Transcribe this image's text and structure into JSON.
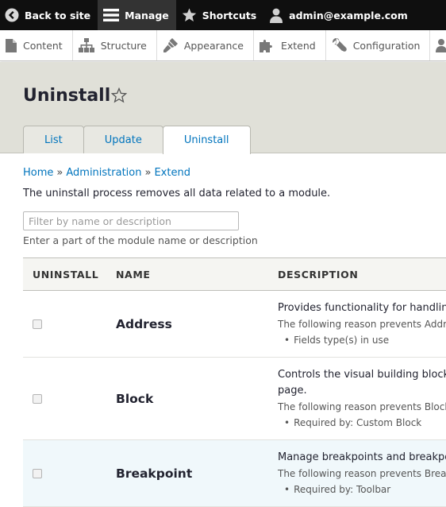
{
  "toolbar": {
    "back_label": "Back to site",
    "manage_label": "Manage",
    "shortcuts_label": "Shortcuts",
    "user_label": "admin@example.com"
  },
  "tray": {
    "items": [
      {
        "label": "Content",
        "icon": "file-icon"
      },
      {
        "label": "Structure",
        "icon": "sitemap-icon"
      },
      {
        "label": "Appearance",
        "icon": "brush-icon"
      },
      {
        "label": "Extend",
        "icon": "puzzle-icon"
      },
      {
        "label": "Configuration",
        "icon": "wrench-icon"
      },
      {
        "label": "",
        "icon": "people-icon"
      }
    ]
  },
  "page": {
    "title": "Uninstall",
    "tabs": [
      {
        "label": "List"
      },
      {
        "label": "Update"
      },
      {
        "label": "Uninstall",
        "active": true
      }
    ]
  },
  "breadcrumb": {
    "items": [
      "Home",
      "Administration",
      "Extend"
    ],
    "separator": "»"
  },
  "intro_text": "The uninstall process removes all data related to a module.",
  "filter": {
    "placeholder": "Filter by name or description",
    "value": "",
    "description": "Enter a part of the module name or description"
  },
  "table": {
    "headers": [
      "UNINSTALL",
      "NAME",
      "DESCRIPTION"
    ],
    "rows": [
      {
        "name": "Address",
        "description": "Provides functionality for handlin",
        "reason": "The following reason prevents Addre",
        "bullets": [
          "Fields type(s) in use"
        ]
      },
      {
        "name": "Block",
        "description": "Controls the visual building block",
        "description2": "page.",
        "reason": "The following reason prevents Block",
        "bullets": [
          "Required by: Custom Block"
        ]
      },
      {
        "name": "Breakpoint",
        "description": "Manage breakpoints and breakpo",
        "reason": "The following reason prevents Break",
        "bullets": [
          "Required by: Toolbar"
        ]
      }
    ]
  },
  "colors": {
    "toolbar_bg": "#0f0f0f",
    "link": "#0074bd",
    "header_bg": "#e0e0d8",
    "highlight_row": "#f0f8fb"
  }
}
